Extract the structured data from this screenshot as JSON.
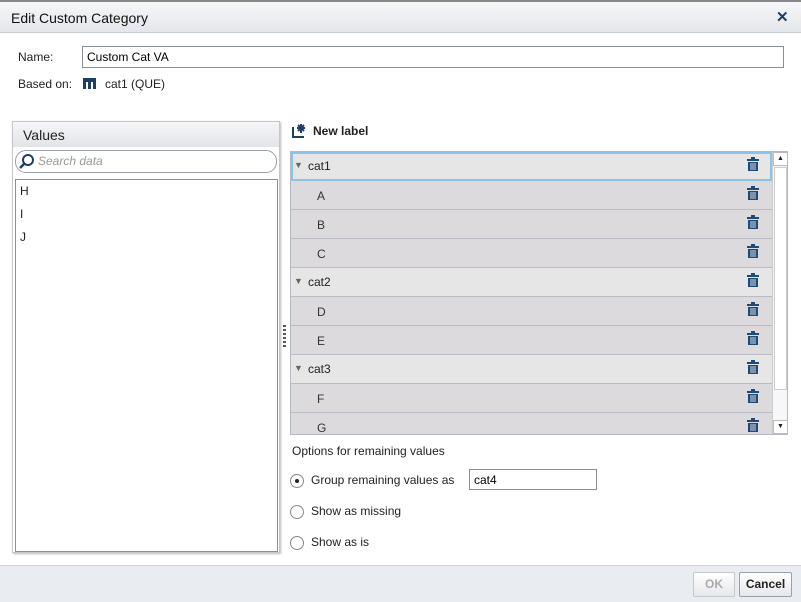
{
  "dialog": {
    "title": "Edit Custom Category"
  },
  "name": {
    "label": "Name:",
    "value": "Custom Cat VA"
  },
  "based_on": {
    "label": "Based on:",
    "value": "cat1 (QUE)"
  },
  "values_panel": {
    "title": "Values",
    "search_placeholder": "Search data",
    "items": [
      "H",
      "I",
      "J"
    ]
  },
  "new_label": "New label",
  "tree": [
    {
      "label": "cat1",
      "type": "group"
    },
    {
      "label": "A",
      "type": "item"
    },
    {
      "label": "B",
      "type": "item"
    },
    {
      "label": "C",
      "type": "item"
    },
    {
      "label": "cat2",
      "type": "group"
    },
    {
      "label": "D",
      "type": "item"
    },
    {
      "label": "E",
      "type": "item"
    },
    {
      "label": "cat3",
      "type": "group"
    },
    {
      "label": "F",
      "type": "item"
    },
    {
      "label": "G",
      "type": "item"
    }
  ],
  "options": {
    "title": "Options for remaining values",
    "group_label": "Group remaining values as",
    "group_value": "cat4",
    "missing_label": "Show as missing",
    "asis_label": "Show as is",
    "selected": "group"
  },
  "buttons": {
    "ok": "OK",
    "cancel": "Cancel"
  }
}
